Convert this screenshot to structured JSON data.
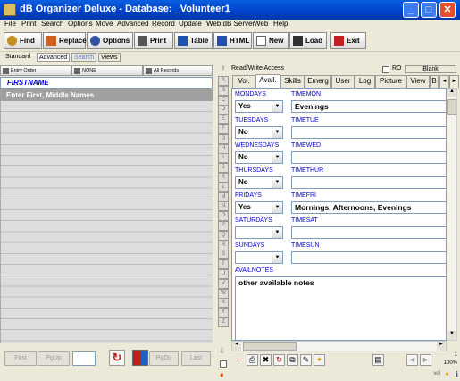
{
  "window": {
    "title": "dB Organizer Deluxe - Database: _Volunteer1",
    "min_label": "_",
    "max_label": "□",
    "close_label": "✕"
  },
  "menu": [
    "File",
    "Print",
    "Search",
    "Options",
    "Move",
    "Advanced",
    "Record",
    "Update",
    "Web dB Server",
    "Web",
    "Help"
  ],
  "toolbar": {
    "find": "Find",
    "replace": "Replace",
    "options": "Options",
    "print": "Print",
    "table": "Table",
    "html": "HTML",
    "new": "New",
    "load": "Load",
    "exit": "Exit"
  },
  "modes": {
    "standard": "Standard",
    "advanced": "Advanced",
    "search": "Search",
    "views": "Views"
  },
  "sort": {
    "entry_order": "Entry Order",
    "none": "NONE",
    "all_records": "All Records"
  },
  "list": {
    "header": "FIRSTNAME",
    "selected": "Enter First, Middle Names"
  },
  "nav": {
    "first": "First",
    "pgup": "PgUp",
    "page_value": "",
    "pgdn": "PgDn",
    "last": "Last"
  },
  "letters": [
    "A",
    "B",
    "C",
    "D",
    "E",
    "F",
    "G",
    "H",
    "I",
    "J",
    "K",
    "L",
    "M",
    "N",
    "O",
    "P",
    "Q",
    "R",
    "S",
    "T",
    "U",
    "V",
    "W",
    "X",
    "Y",
    "Z"
  ],
  "access": {
    "label": "Read/Write Access",
    "ro": "RO",
    "blank": "Blank"
  },
  "tabs": [
    "Vol.",
    "Avail.",
    "Skills",
    "Emerg",
    "User",
    "Log",
    "Picture",
    "View",
    "B"
  ],
  "fields": {
    "mondays": {
      "label": "MONDAYS",
      "value": "Yes"
    },
    "timemon": {
      "label": "TIMEMON",
      "value": "Evenings"
    },
    "tuesdays": {
      "label": "TUESDAYS",
      "value": "No"
    },
    "timetue": {
      "label": "TIMETUE",
      "value": ""
    },
    "wednesdays": {
      "label": "WEDNESDAYS",
      "value": "No"
    },
    "timewed": {
      "label": "TIMEWED",
      "value": ""
    },
    "thursdays": {
      "label": "THURSDAYS",
      "value": "No"
    },
    "timethur": {
      "label": "TIMETHUR",
      "value": ""
    },
    "fridays": {
      "label": "FRIDAYS",
      "value": "Yes"
    },
    "timefri": {
      "label": "TIMEFRI",
      "value": "Mornings, Afternoons, Evenings"
    },
    "saturdays": {
      "label": "SATURDAYS",
      "value": ""
    },
    "timesat": {
      "label": "TIMESAT",
      "value": ""
    },
    "sundays": {
      "label": "SUNDAYS",
      "value": ""
    },
    "timesun": {
      "label": "TIMESUN",
      "value": ""
    },
    "availnotes": {
      "label": "AVAILNOTES",
      "value": "other available notes"
    }
  },
  "status": {
    "count": "1",
    "zoom": "100%",
    "vol": "vol"
  },
  "colors": {
    "title_blue": "#0041c8",
    "field_label": "#0000cc",
    "selected_row": "#a0a0a0"
  }
}
